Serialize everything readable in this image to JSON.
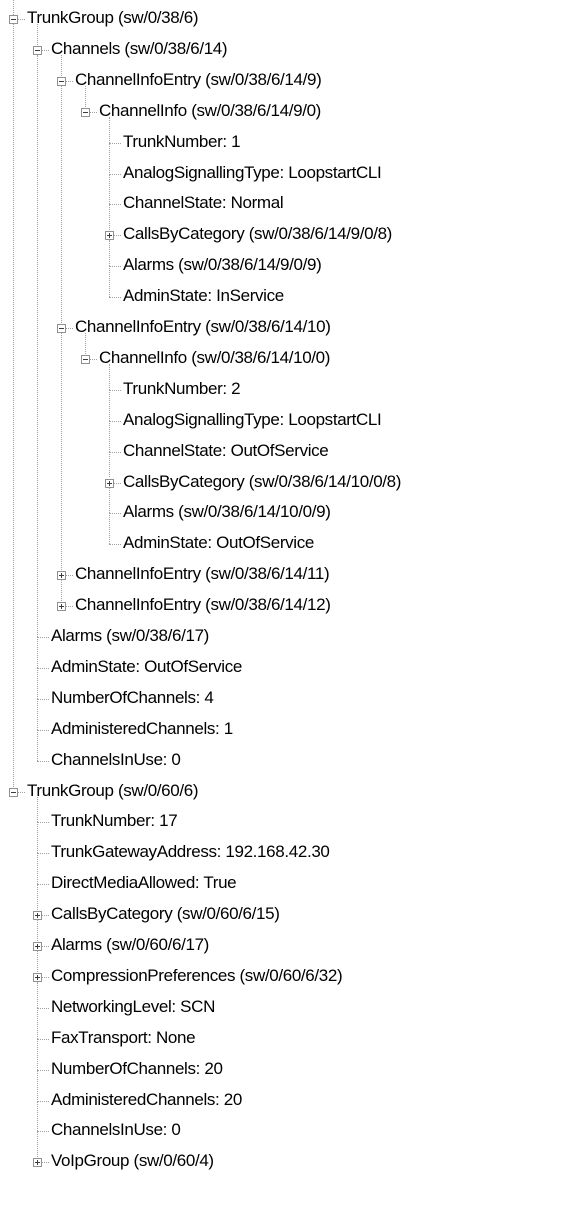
{
  "tree": {
    "nodes": [
      {
        "level": 0,
        "label": "TrunkGroup (sw/0/38/6)",
        "expandable": true,
        "expanded": true,
        "name": "tree-node-trunkgroup-38-6"
      },
      {
        "level": 1,
        "label": "Channels (sw/0/38/6/14)",
        "expandable": true,
        "expanded": true,
        "name": "tree-node-channels"
      },
      {
        "level": 2,
        "label": "ChannelInfoEntry (sw/0/38/6/14/9)",
        "expandable": true,
        "expanded": true,
        "name": "tree-node-channelinfoentry-9"
      },
      {
        "level": 3,
        "label": "ChannelInfo (sw/0/38/6/14/9/0)",
        "expandable": true,
        "expanded": true,
        "name": "tree-node-channelinfo-9-0"
      },
      {
        "level": 4,
        "label": "TrunkNumber: 1",
        "expandable": false,
        "name": "tree-leaf-trunknumber"
      },
      {
        "level": 4,
        "label": "AnalogSignallingType: LoopstartCLI",
        "expandable": false,
        "name": "tree-leaf-analogsignallingtype"
      },
      {
        "level": 4,
        "label": "ChannelState: Normal",
        "expandable": false,
        "name": "tree-leaf-channelstate"
      },
      {
        "level": 4,
        "label": "CallsByCategory (sw/0/38/6/14/9/0/8)",
        "expandable": true,
        "expanded": false,
        "name": "tree-node-callsbycategory"
      },
      {
        "level": 4,
        "label": "Alarms (sw/0/38/6/14/9/0/9)",
        "expandable": false,
        "name": "tree-leaf-alarms"
      },
      {
        "level": 4,
        "label": "AdminState: InService",
        "expandable": false,
        "name": "tree-leaf-adminstate"
      },
      {
        "level": 2,
        "label": "ChannelInfoEntry (sw/0/38/6/14/10)",
        "expandable": true,
        "expanded": true,
        "name": "tree-node-channelinfoentry-10"
      },
      {
        "level": 3,
        "label": "ChannelInfo (sw/0/38/6/14/10/0)",
        "expandable": true,
        "expanded": true,
        "name": "tree-node-channelinfo-10-0"
      },
      {
        "level": 4,
        "label": "TrunkNumber: 2",
        "expandable": false,
        "name": "tree-leaf-trunknumber"
      },
      {
        "level": 4,
        "label": "AnalogSignallingType: LoopstartCLI",
        "expandable": false,
        "name": "tree-leaf-analogsignallingtype"
      },
      {
        "level": 4,
        "label": "ChannelState: OutOfService",
        "expandable": false,
        "name": "tree-leaf-channelstate"
      },
      {
        "level": 4,
        "label": "CallsByCategory (sw/0/38/6/14/10/0/8)",
        "expandable": true,
        "expanded": false,
        "name": "tree-node-callsbycategory"
      },
      {
        "level": 4,
        "label": "Alarms (sw/0/38/6/14/10/0/9)",
        "expandable": false,
        "name": "tree-leaf-alarms"
      },
      {
        "level": 4,
        "label": "AdminState: OutOfService",
        "expandable": false,
        "name": "tree-leaf-adminstate"
      },
      {
        "level": 2,
        "label": "ChannelInfoEntry (sw/0/38/6/14/11)",
        "expandable": true,
        "expanded": false,
        "name": "tree-node-channelinfoentry-11"
      },
      {
        "level": 2,
        "label": "ChannelInfoEntry (sw/0/38/6/14/12)",
        "expandable": true,
        "expanded": false,
        "name": "tree-node-channelinfoentry-12"
      },
      {
        "level": 1,
        "label": "Alarms (sw/0/38/6/17)",
        "expandable": false,
        "name": "tree-leaf-alarms"
      },
      {
        "level": 1,
        "label": "AdminState: OutOfService",
        "expandable": false,
        "name": "tree-leaf-adminstate"
      },
      {
        "level": 1,
        "label": "NumberOfChannels: 4",
        "expandable": false,
        "name": "tree-leaf-numberofchannels"
      },
      {
        "level": 1,
        "label": "AdministeredChannels: 1",
        "expandable": false,
        "name": "tree-leaf-administeredchannels"
      },
      {
        "level": 1,
        "label": "ChannelsInUse: 0",
        "expandable": false,
        "name": "tree-leaf-channelsinuse"
      },
      {
        "level": 0,
        "label": "TrunkGroup (sw/0/60/6)",
        "expandable": true,
        "expanded": true,
        "name": "tree-node-trunkgroup-60-6"
      },
      {
        "level": 1,
        "label": "TrunkNumber: 17",
        "expandable": false,
        "name": "tree-leaf-trunknumber"
      },
      {
        "level": 1,
        "label": "TrunkGatewayAddress: 192.168.42.30",
        "expandable": false,
        "name": "tree-leaf-trunkgatewayaddress"
      },
      {
        "level": 1,
        "label": "DirectMediaAllowed: True",
        "expandable": false,
        "name": "tree-leaf-directmediaallowed"
      },
      {
        "level": 1,
        "label": "CallsByCategory (sw/0/60/6/15)",
        "expandable": true,
        "expanded": false,
        "name": "tree-node-callsbycategory"
      },
      {
        "level": 1,
        "label": "Alarms (sw/0/60/6/17)",
        "expandable": true,
        "expanded": false,
        "name": "tree-node-alarms"
      },
      {
        "level": 1,
        "label": "CompressionPreferences (sw/0/60/6/32)",
        "expandable": true,
        "expanded": false,
        "name": "tree-node-compressionpreferences"
      },
      {
        "level": 1,
        "label": "NetworkingLevel: SCN",
        "expandable": false,
        "name": "tree-leaf-networkinglevel"
      },
      {
        "level": 1,
        "label": "FaxTransport: None",
        "expandable": false,
        "name": "tree-leaf-faxtransport"
      },
      {
        "level": 1,
        "label": "NumberOfChannels: 20",
        "expandable": false,
        "name": "tree-leaf-numberofchannels"
      },
      {
        "level": 1,
        "label": "AdministeredChannels: 20",
        "expandable": false,
        "name": "tree-leaf-administeredchannels"
      },
      {
        "level": 1,
        "label": "ChannelsInUse: 0",
        "expandable": false,
        "name": "tree-leaf-channelsinuse"
      },
      {
        "level": 1,
        "label": "VoIpGroup (sw/0/60/4)",
        "expandable": true,
        "expanded": false,
        "name": "tree-node-voipgroup"
      }
    ]
  }
}
